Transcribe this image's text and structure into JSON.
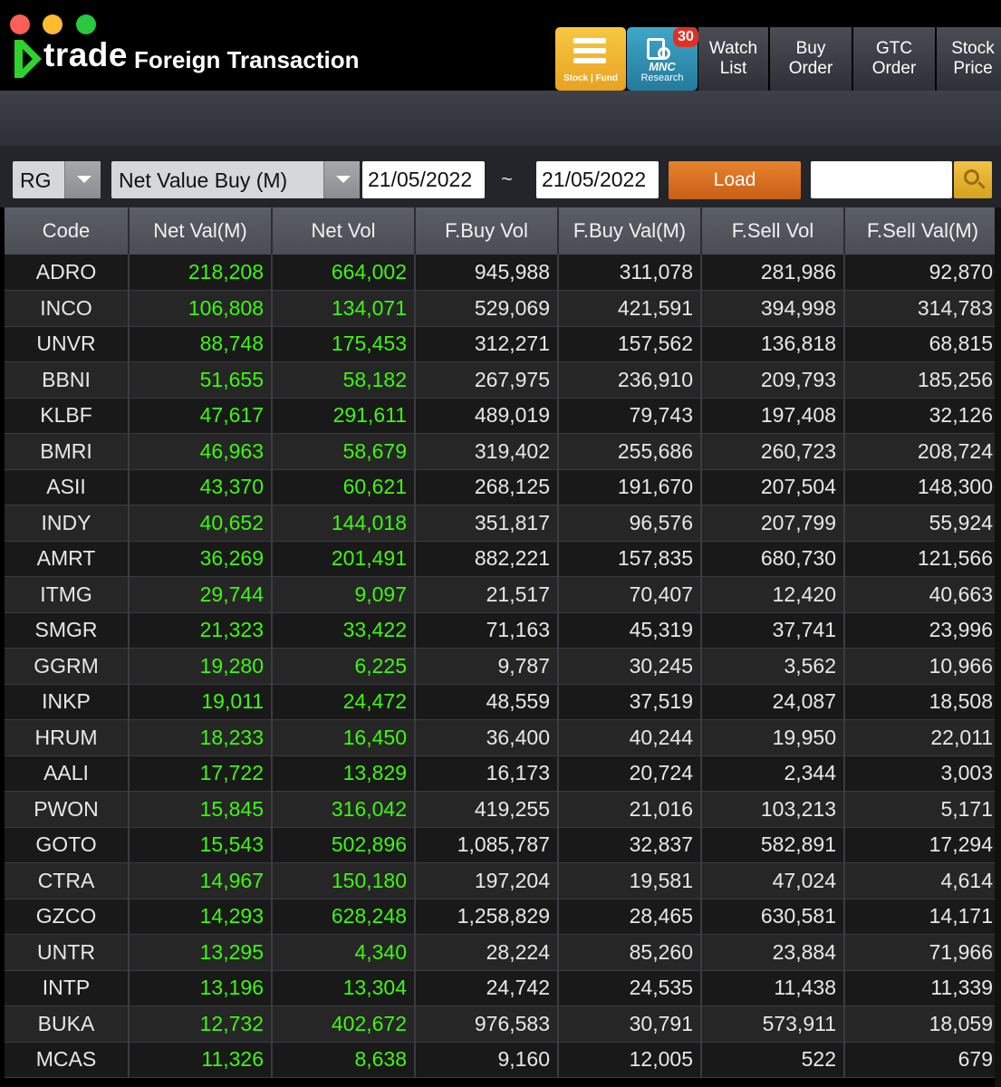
{
  "app": {
    "logo_text": "trade",
    "title": "Foreign Transaction"
  },
  "header": {
    "stock_fund_label": "Stock | Fund",
    "research_brand": "MNC",
    "research_label": "Research",
    "research_badge": "30",
    "menu": [
      {
        "line1": "Watch",
        "line2": "List"
      },
      {
        "line1": "Buy",
        "line2": "Order"
      },
      {
        "line1": "GTC",
        "line2": "Order"
      },
      {
        "line1": "Stock",
        "line2": "Price"
      }
    ]
  },
  "filters": {
    "board": "RG",
    "sort_by": "Net Value Buy (M)",
    "date_from": "21/05/2022",
    "separator": "~",
    "date_to": "21/05/2022",
    "load_label": "Load",
    "search_value": ""
  },
  "colors": {
    "positive": "#3ef70e",
    "load_button": "#d8701f",
    "accent_yellow": "#f2c246"
  },
  "table": {
    "columns": [
      "Code",
      "Net Val(M)",
      "Net Vol",
      "F.Buy Vol",
      "F.Buy Val(M)",
      "F.Sell Vol",
      "F.Sell Val(M)"
    ],
    "rows": [
      [
        "ADRO",
        "218,208",
        "664,002",
        "945,988",
        "311,078",
        "281,986",
        "92,870"
      ],
      [
        "INCO",
        "106,808",
        "134,071",
        "529,069",
        "421,591",
        "394,998",
        "314,783"
      ],
      [
        "UNVR",
        "88,748",
        "175,453",
        "312,271",
        "157,562",
        "136,818",
        "68,815"
      ],
      [
        "BBNI",
        "51,655",
        "58,182",
        "267,975",
        "236,910",
        "209,793",
        "185,256"
      ],
      [
        "KLBF",
        "47,617",
        "291,611",
        "489,019",
        "79,743",
        "197,408",
        "32,126"
      ],
      [
        "BMRI",
        "46,963",
        "58,679",
        "319,402",
        "255,686",
        "260,723",
        "208,724"
      ],
      [
        "ASII",
        "43,370",
        "60,621",
        "268,125",
        "191,670",
        "207,504",
        "148,300"
      ],
      [
        "INDY",
        "40,652",
        "144,018",
        "351,817",
        "96,576",
        "207,799",
        "55,924"
      ],
      [
        "AMRT",
        "36,269",
        "201,491",
        "882,221",
        "157,835",
        "680,730",
        "121,566"
      ],
      [
        "ITMG",
        "29,744",
        "9,097",
        "21,517",
        "70,407",
        "12,420",
        "40,663"
      ],
      [
        "SMGR",
        "21,323",
        "33,422",
        "71,163",
        "45,319",
        "37,741",
        "23,996"
      ],
      [
        "GGRM",
        "19,280",
        "6,225",
        "9,787",
        "30,245",
        "3,562",
        "10,966"
      ],
      [
        "INKP",
        "19,011",
        "24,472",
        "48,559",
        "37,519",
        "24,087",
        "18,508"
      ],
      [
        "HRUM",
        "18,233",
        "16,450",
        "36,400",
        "40,244",
        "19,950",
        "22,011"
      ],
      [
        "AALI",
        "17,722",
        "13,829",
        "16,173",
        "20,724",
        "2,344",
        "3,003"
      ],
      [
        "PWON",
        "15,845",
        "316,042",
        "419,255",
        "21,016",
        "103,213",
        "5,171"
      ],
      [
        "GOTO",
        "15,543",
        "502,896",
        "1,085,787",
        "32,837",
        "582,891",
        "17,294"
      ],
      [
        "CTRA",
        "14,967",
        "150,180",
        "197,204",
        "19,581",
        "47,024",
        "4,614"
      ],
      [
        "GZCO",
        "14,293",
        "628,248",
        "1,258,829",
        "28,465",
        "630,581",
        "14,171"
      ],
      [
        "UNTR",
        "13,295",
        "4,340",
        "28,224",
        "85,260",
        "23,884",
        "71,966"
      ],
      [
        "INTP",
        "13,196",
        "13,304",
        "24,742",
        "24,535",
        "11,438",
        "11,339"
      ],
      [
        "BUKA",
        "12,732",
        "402,672",
        "976,583",
        "30,791",
        "573,911",
        "18,059"
      ],
      [
        "MCAS",
        "11,326",
        "8,638",
        "9,160",
        "12,005",
        "522",
        "679"
      ]
    ]
  }
}
